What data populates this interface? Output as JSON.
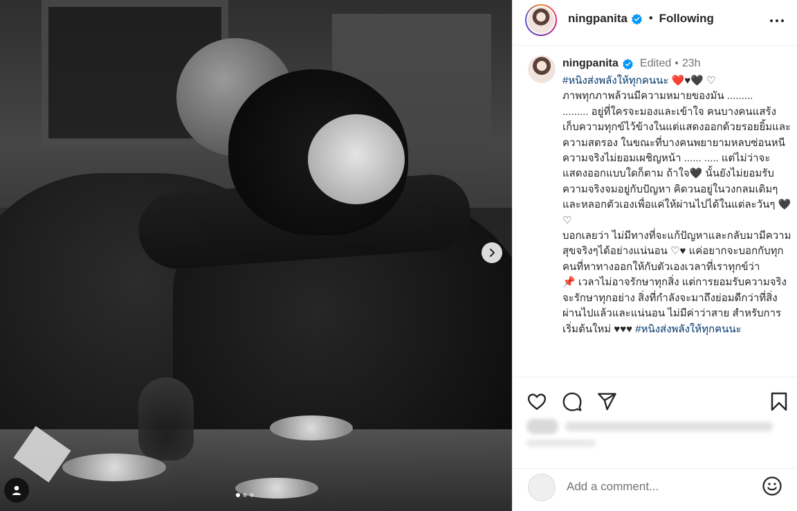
{
  "post": {
    "username": "ningpanita",
    "follow_state": "Following",
    "bullet": "•",
    "edited_label": "Edited",
    "time_sep": "•",
    "time": "23h",
    "caption_hashtag_open": "#หนิงส่งพลังให้ทุกคนนะ",
    "caption_hearts_open": " ❤️♥🖤 ♡",
    "caption_body": "\nภาพทุกภาพล้วนมีความหมายของมัน .........\n......... อยู่ที่ใครจะมองและเข้าใจ คนบางคนแสร้งเก็บความทุกข์ไว้ข้างในแต่แสดงออกด้วยรอยยิ้มและความสตรอง ในขณะที่บางคนพยายามหลบซ่อนหนีความจริงไม่ยอมเผชิญหน้า ...... ..... แต่ไม่ว่าจะแสดงออกแบบใดก็ตาม ถ้าใจ🖤 นั้นยังไม่ยอมรับความจริงจมอยู่กับปัญหา คิดวนอยู่ในวงกลมเดิมๆ และหลอกตัวเองเพื่อแค่ให้ผ่านไปได้ในแต่ละวันๆ 🖤 ♡\nบอกเลยว่า ไม่มีทางที่จะแก้ปัญหาและกลับมามีความสุขจริงๆได้อย่างแน่นอน ♡♥ แค่อยากจะบอกกับทุกคนที่หาทางออกให้กับตัวเองเวลาที่เราทุกข์ว่า\n📌 เวลาไม่อาจรักษาทุกสิ่ง แต่การยอมรับความจริงจะรักษาทุกอย่าง สิ่งที่กำลังจะมาถึงย่อมดีกว่าที่สิ่งผ่านไปแล้วและแน่นอน ไม่มีค่าว่าสาย สำหรับการเริ่มต้นใหม่ ♥♥♥ ",
    "caption_hashtag_close": "#หนิงส่งพลังให้ทุกคนนะ"
  },
  "comment": {
    "placeholder": "Add a comment..."
  },
  "icons": {
    "verified": "verified-badge-icon",
    "more": "more-options-icon",
    "like": "heart-icon",
    "comment": "comment-bubble-icon",
    "share": "paper-plane-icon",
    "save": "bookmark-icon",
    "emoji": "emoji-smile-icon",
    "next": "chevron-right-icon",
    "tag": "user-tag-icon"
  },
  "carousel": {
    "total": 3,
    "active": 0
  },
  "colors": {
    "verified_blue": "#0095f6",
    "hashtag": "#00376b",
    "muted": "#737373"
  }
}
